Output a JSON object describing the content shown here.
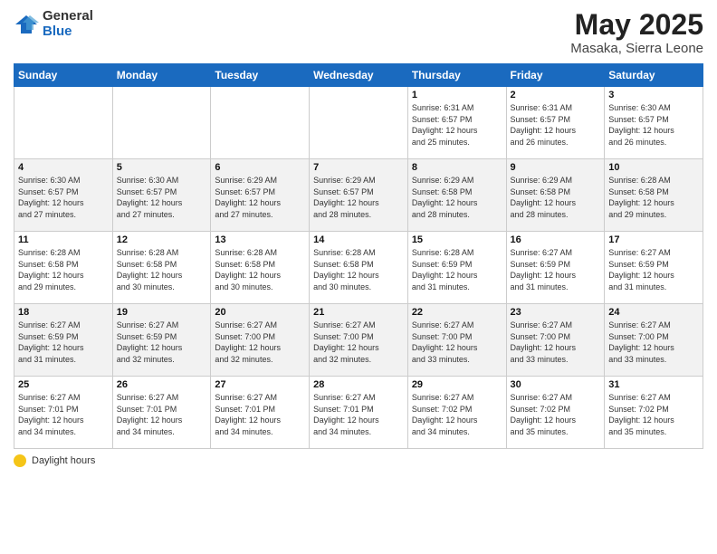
{
  "logo": {
    "general": "General",
    "blue": "Blue"
  },
  "title": "May 2025",
  "subtitle": "Masaka, Sierra Leone",
  "days_header": [
    "Sunday",
    "Monday",
    "Tuesday",
    "Wednesday",
    "Thursday",
    "Friday",
    "Saturday"
  ],
  "weeks": [
    [
      {
        "day": "",
        "info": ""
      },
      {
        "day": "",
        "info": ""
      },
      {
        "day": "",
        "info": ""
      },
      {
        "day": "",
        "info": ""
      },
      {
        "day": "1",
        "info": "Sunrise: 6:31 AM\nSunset: 6:57 PM\nDaylight: 12 hours\nand 25 minutes."
      },
      {
        "day": "2",
        "info": "Sunrise: 6:31 AM\nSunset: 6:57 PM\nDaylight: 12 hours\nand 26 minutes."
      },
      {
        "day": "3",
        "info": "Sunrise: 6:30 AM\nSunset: 6:57 PM\nDaylight: 12 hours\nand 26 minutes."
      }
    ],
    [
      {
        "day": "4",
        "info": "Sunrise: 6:30 AM\nSunset: 6:57 PM\nDaylight: 12 hours\nand 27 minutes."
      },
      {
        "day": "5",
        "info": "Sunrise: 6:30 AM\nSunset: 6:57 PM\nDaylight: 12 hours\nand 27 minutes."
      },
      {
        "day": "6",
        "info": "Sunrise: 6:29 AM\nSunset: 6:57 PM\nDaylight: 12 hours\nand 27 minutes."
      },
      {
        "day": "7",
        "info": "Sunrise: 6:29 AM\nSunset: 6:57 PM\nDaylight: 12 hours\nand 28 minutes."
      },
      {
        "day": "8",
        "info": "Sunrise: 6:29 AM\nSunset: 6:58 PM\nDaylight: 12 hours\nand 28 minutes."
      },
      {
        "day": "9",
        "info": "Sunrise: 6:29 AM\nSunset: 6:58 PM\nDaylight: 12 hours\nand 28 minutes."
      },
      {
        "day": "10",
        "info": "Sunrise: 6:28 AM\nSunset: 6:58 PM\nDaylight: 12 hours\nand 29 minutes."
      }
    ],
    [
      {
        "day": "11",
        "info": "Sunrise: 6:28 AM\nSunset: 6:58 PM\nDaylight: 12 hours\nand 29 minutes."
      },
      {
        "day": "12",
        "info": "Sunrise: 6:28 AM\nSunset: 6:58 PM\nDaylight: 12 hours\nand 30 minutes."
      },
      {
        "day": "13",
        "info": "Sunrise: 6:28 AM\nSunset: 6:58 PM\nDaylight: 12 hours\nand 30 minutes."
      },
      {
        "day": "14",
        "info": "Sunrise: 6:28 AM\nSunset: 6:58 PM\nDaylight: 12 hours\nand 30 minutes."
      },
      {
        "day": "15",
        "info": "Sunrise: 6:28 AM\nSunset: 6:59 PM\nDaylight: 12 hours\nand 31 minutes."
      },
      {
        "day": "16",
        "info": "Sunrise: 6:27 AM\nSunset: 6:59 PM\nDaylight: 12 hours\nand 31 minutes."
      },
      {
        "day": "17",
        "info": "Sunrise: 6:27 AM\nSunset: 6:59 PM\nDaylight: 12 hours\nand 31 minutes."
      }
    ],
    [
      {
        "day": "18",
        "info": "Sunrise: 6:27 AM\nSunset: 6:59 PM\nDaylight: 12 hours\nand 31 minutes."
      },
      {
        "day": "19",
        "info": "Sunrise: 6:27 AM\nSunset: 6:59 PM\nDaylight: 12 hours\nand 32 minutes."
      },
      {
        "day": "20",
        "info": "Sunrise: 6:27 AM\nSunset: 7:00 PM\nDaylight: 12 hours\nand 32 minutes."
      },
      {
        "day": "21",
        "info": "Sunrise: 6:27 AM\nSunset: 7:00 PM\nDaylight: 12 hours\nand 32 minutes."
      },
      {
        "day": "22",
        "info": "Sunrise: 6:27 AM\nSunset: 7:00 PM\nDaylight: 12 hours\nand 33 minutes."
      },
      {
        "day": "23",
        "info": "Sunrise: 6:27 AM\nSunset: 7:00 PM\nDaylight: 12 hours\nand 33 minutes."
      },
      {
        "day": "24",
        "info": "Sunrise: 6:27 AM\nSunset: 7:00 PM\nDaylight: 12 hours\nand 33 minutes."
      }
    ],
    [
      {
        "day": "25",
        "info": "Sunrise: 6:27 AM\nSunset: 7:01 PM\nDaylight: 12 hours\nand 34 minutes."
      },
      {
        "day": "26",
        "info": "Sunrise: 6:27 AM\nSunset: 7:01 PM\nDaylight: 12 hours\nand 34 minutes."
      },
      {
        "day": "27",
        "info": "Sunrise: 6:27 AM\nSunset: 7:01 PM\nDaylight: 12 hours\nand 34 minutes."
      },
      {
        "day": "28",
        "info": "Sunrise: 6:27 AM\nSunset: 7:01 PM\nDaylight: 12 hours\nand 34 minutes."
      },
      {
        "day": "29",
        "info": "Sunrise: 6:27 AM\nSunset: 7:02 PM\nDaylight: 12 hours\nand 34 minutes."
      },
      {
        "day": "30",
        "info": "Sunrise: 6:27 AM\nSunset: 7:02 PM\nDaylight: 12 hours\nand 35 minutes."
      },
      {
        "day": "31",
        "info": "Sunrise: 6:27 AM\nSunset: 7:02 PM\nDaylight: 12 hours\nand 35 minutes."
      }
    ]
  ],
  "footer": {
    "daylight_label": "Daylight hours"
  }
}
